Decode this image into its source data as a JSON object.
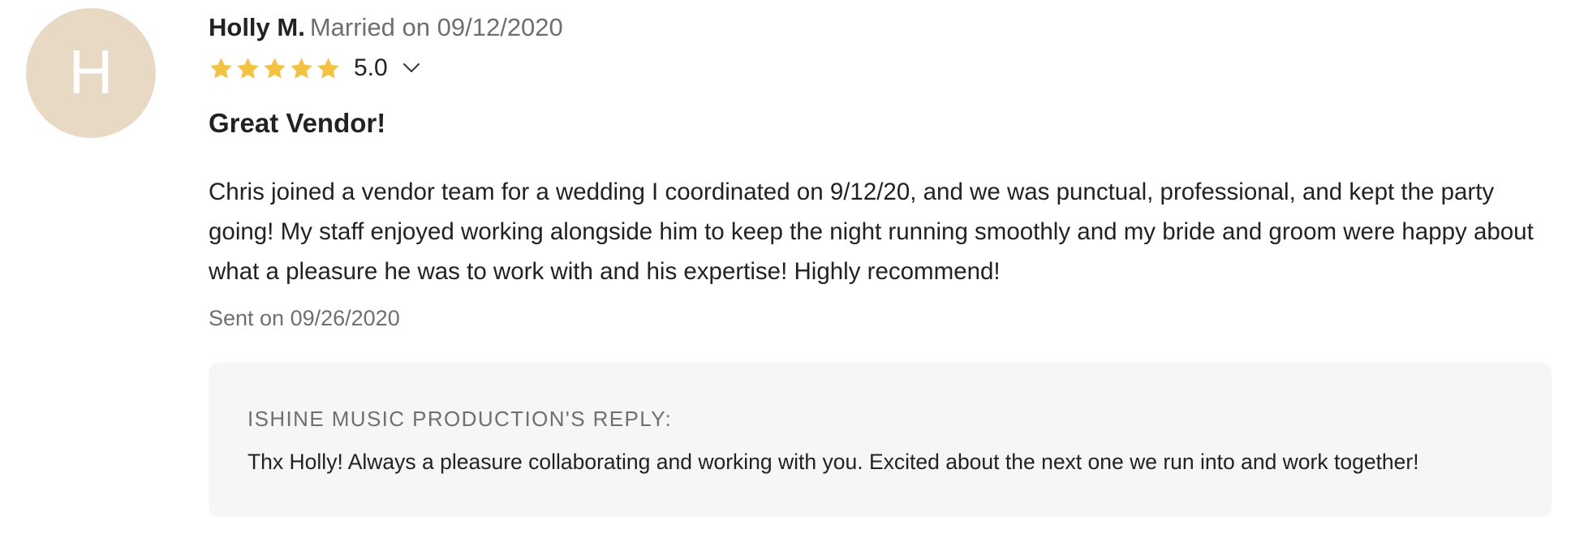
{
  "review": {
    "avatar_initial": "H",
    "reviewer_name": "Holly M.",
    "married_label": "Married on 09/12/2020",
    "rating": 5,
    "rating_label": "5.0",
    "star_color": "#f4c243",
    "title": "Great Vendor!",
    "body": "Chris joined a vendor team for a wedding I coordinated on 9/12/20, and we was punctual, professional, and kept the party going! My staff enjoyed working alongside him to keep the night running smoothly and my bride and groom were happy about what a pleasure he was to work with and his expertise! Highly recommend!",
    "sent_date": "Sent on 09/26/2020"
  },
  "reply": {
    "heading": "ISHINE MUSIC PRODUCTION'S REPLY:",
    "body": "Thx Holly! Always a pleasure collaborating and working with you. Excited about the next one we run into and work together!"
  },
  "icons": {
    "star": "star-icon",
    "expand": "chevron-down-icon"
  },
  "colors": {
    "avatar_background": "#e8d9c5",
    "muted_text": "#6f6f6f",
    "reply_background": "#f6f6f6"
  }
}
